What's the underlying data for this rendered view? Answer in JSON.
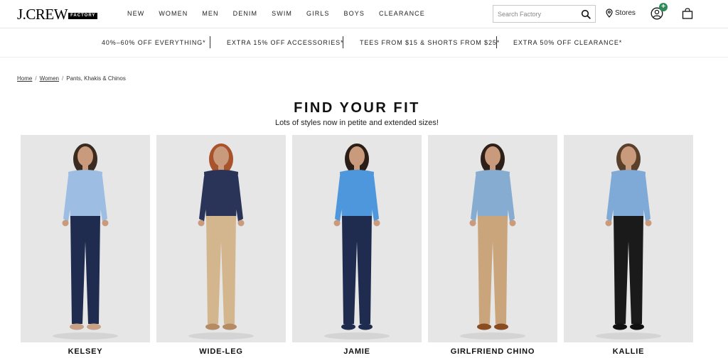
{
  "header": {
    "logo": "J.CREW",
    "logo_badge": "FACTORY",
    "nav": [
      "NEW",
      "WOMEN",
      "MEN",
      "DENIM",
      "SWIM",
      "GIRLS",
      "BOYS",
      "CLEARANCE"
    ],
    "search_placeholder": "Search Factory",
    "stores_label": "Stores",
    "account_badge": "+"
  },
  "promo": {
    "items": [
      "40%–60% OFF EVERYTHING*",
      "EXTRA 15% OFF ACCESSORIES*",
      "TEES FROM $15 & SHORTS FROM $25*",
      "EXTRA 50% OFF CLEARANCE*"
    ]
  },
  "breadcrumb": {
    "home": "Home",
    "women": "Women",
    "current": "Pants, Khakis & Chinos",
    "separator": "/"
  },
  "main": {
    "title": "FIND YOUR FIT",
    "subtitle": "Lots of styles now in petite and extended sizes!",
    "products": [
      {
        "name": "KELSEY",
        "top_color": "#9dbde3",
        "pants_color": "#1f2c4f",
        "hair_color": "#3b2a20",
        "shoe_color": "#c9a187"
      },
      {
        "name": "WIDE-LEG",
        "top_color": "#2a3358",
        "pants_color": "#d3b58e",
        "hair_color": "#a9532d",
        "shoe_color": "#b58b63"
      },
      {
        "name": "JAMIE",
        "top_color": "#4f97dd",
        "pants_color": "#1f2c4f",
        "hair_color": "#2b1e17",
        "shoe_color": "#1f2c4f"
      },
      {
        "name": "GIRLFRIEND CHINO",
        "top_color": "#86acd2",
        "pants_color": "#caa57c",
        "hair_color": "#2e2019",
        "shoe_color": "#8a4d22"
      },
      {
        "name": "KALLIE",
        "top_color": "#7fa9d6",
        "pants_color": "#1a1a1a",
        "hair_color": "#5a3f2a",
        "shoe_color": "#111111"
      }
    ]
  }
}
